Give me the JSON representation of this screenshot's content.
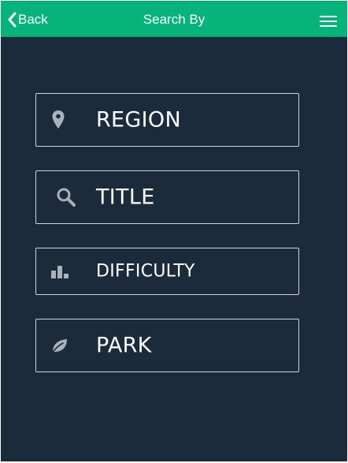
{
  "header": {
    "back_label": "Back",
    "title": "Search By",
    "back_icon": "chevron-left-icon",
    "menu_icon": "hamburger-menu-icon"
  },
  "options": [
    {
      "label": "REGION",
      "icon": "location-pin-icon"
    },
    {
      "label": "TITLE",
      "icon": "search-icon"
    },
    {
      "label": "DIFFICULTY",
      "icon": "bar-chart-icon"
    },
    {
      "label": "PARK",
      "icon": "leaf-icon"
    }
  ],
  "colors": {
    "header_bg": "#06b37b",
    "page_bg": "#1c2b3b",
    "icon": "#a9b1ba",
    "text": "#ffffff"
  }
}
